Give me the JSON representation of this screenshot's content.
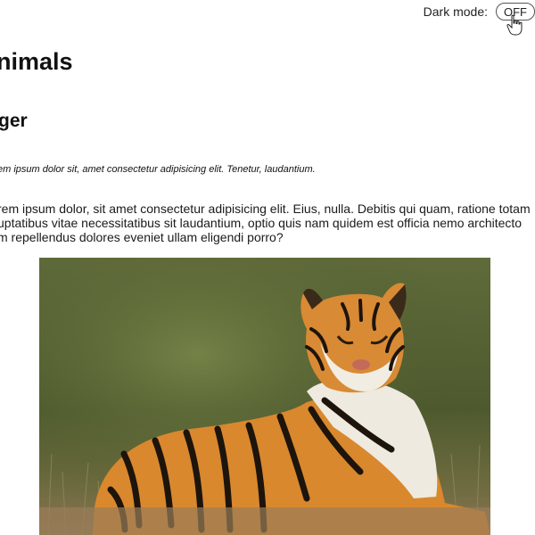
{
  "header": {
    "dark_mode_label": "Dark mode:",
    "dark_mode_toggle": "OFF"
  },
  "site": {
    "title": "nimals"
  },
  "article": {
    "title": "ger",
    "subtitle": "em ipsum dolor sit, amet consectetur adipisicing elit. Tenetur, laudantium.",
    "body_lines": [
      "rem ipsum dolor, sit amet consectetur adipisicing elit. Eius, nulla. Debitis qui quam, ratione totam",
      "uptatibus vitae necessitatibus sit laudantium, optio quis nam quidem est officia nemo architecto",
      "m repellendus dolores eveniet ullam eligendi porro?"
    ]
  },
  "photo": {
    "icon": "tiger-photo",
    "colors": {
      "background": "#5b6b3a",
      "fur": "#d9882e",
      "stripe": "#1d140c",
      "white": "#eeeae0"
    }
  }
}
